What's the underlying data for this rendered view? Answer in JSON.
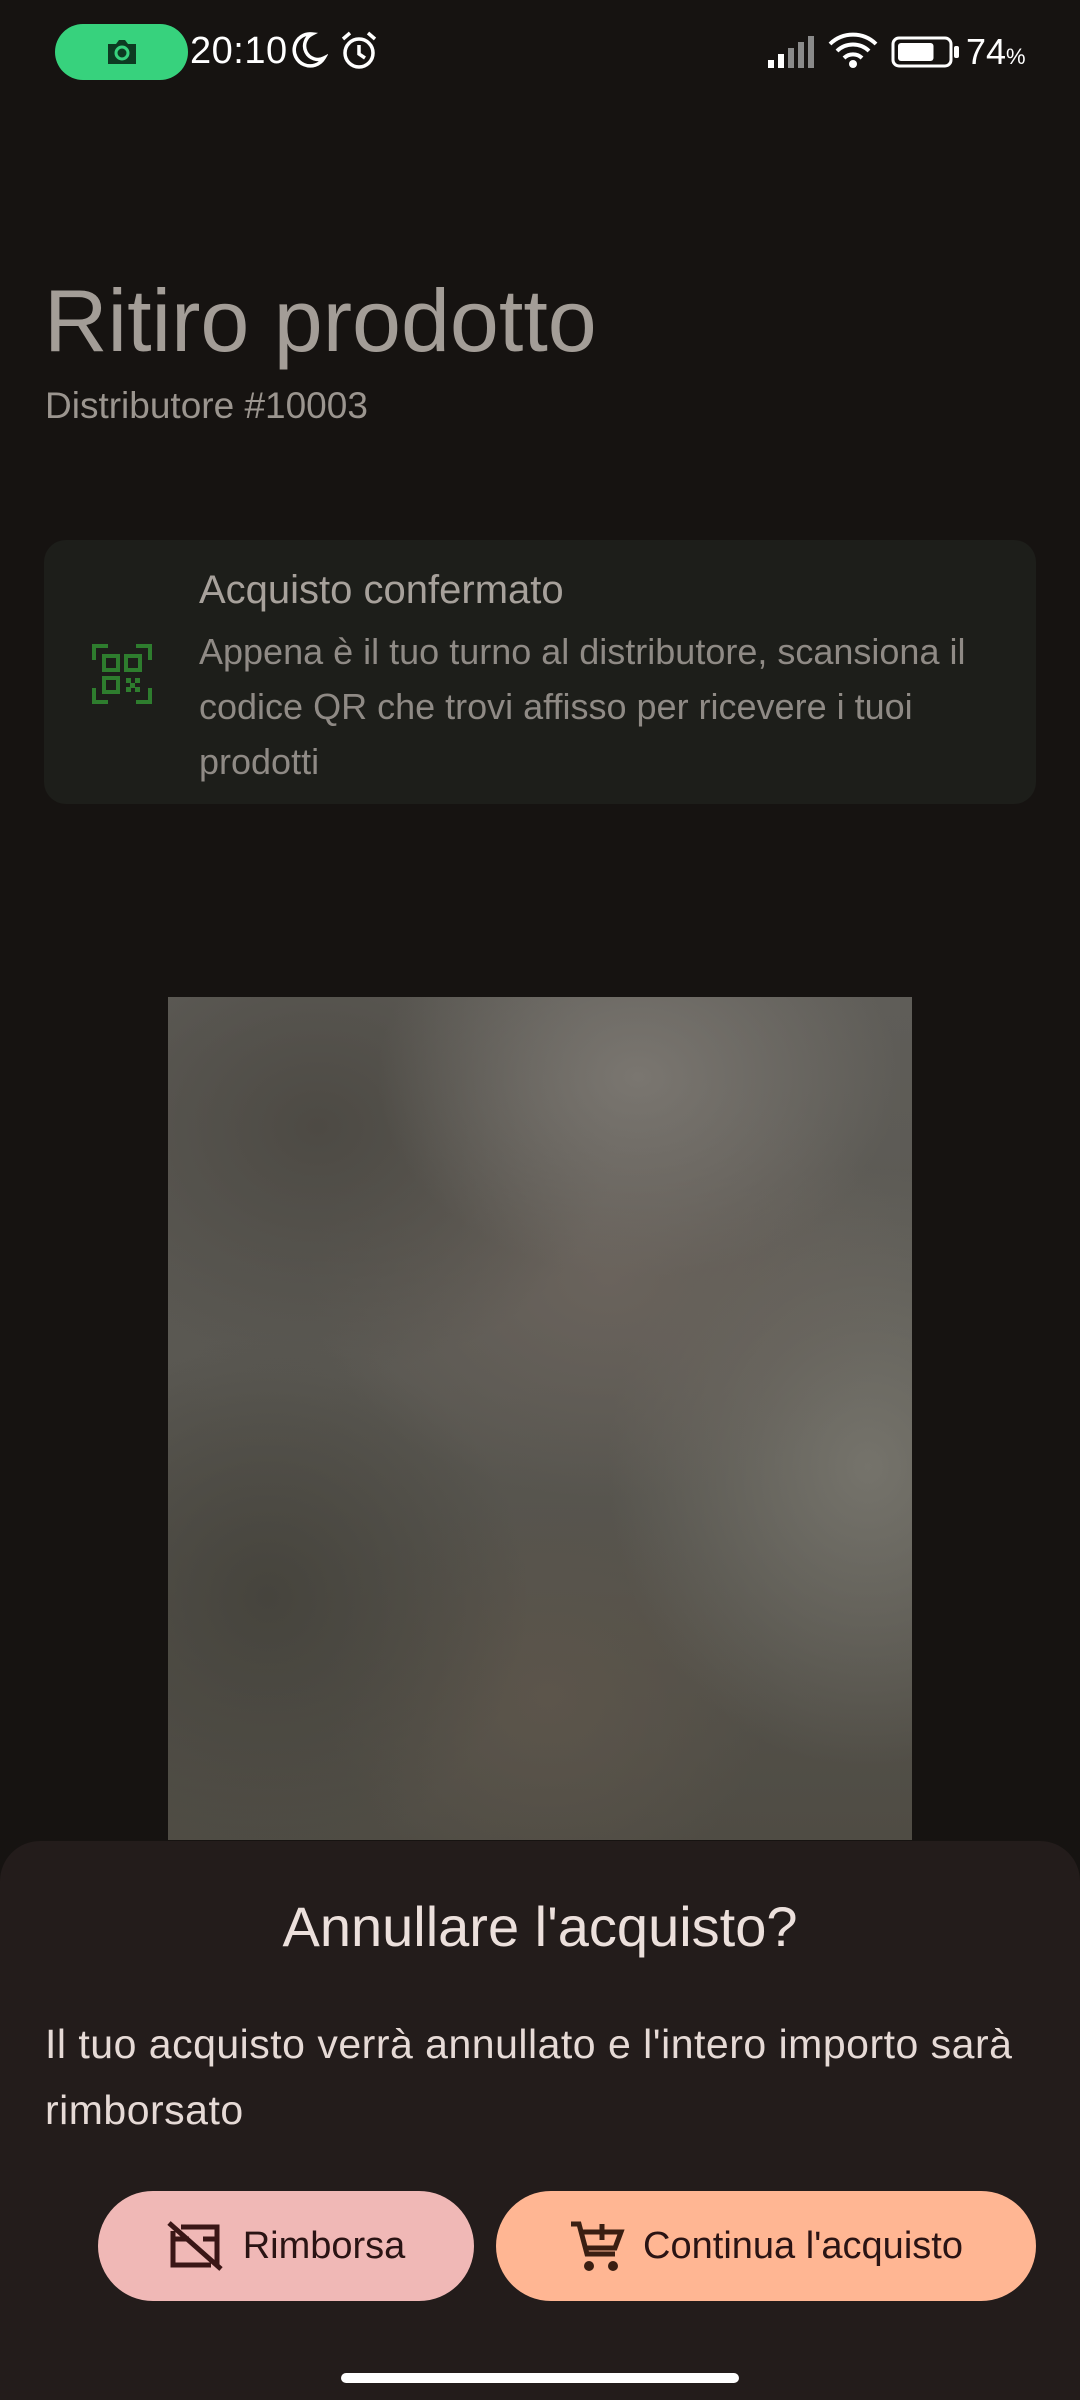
{
  "status_bar": {
    "time": "20:10",
    "battery_text": "74",
    "battery_unit": "%",
    "battery_level": 0.74,
    "icons": [
      "camera-icon",
      "moon-icon",
      "alarm-icon",
      "signal-icon",
      "wifi-icon",
      "battery-icon"
    ]
  },
  "header": {
    "title": "Ritiro prodotto",
    "subtitle": "Distributore #10003"
  },
  "info_card": {
    "icon": "qr-code-scan-icon",
    "title": "Acquisto confermato",
    "text": "Appena è il tuo turno al distributore, scansiona il codice QR che trovi affisso per ricevere i tuoi prodotti"
  },
  "dialog": {
    "title": "Annullare l'acquisto?",
    "body": "Il tuo acquisto verrà annullato e l'intero importo sarà rimborsato",
    "refund_button": {
      "label": "Rimborsa",
      "icon": "card-off-icon"
    },
    "continue_button": {
      "label": "Continua l'acquisto",
      "icon": "add-cart-icon"
    }
  },
  "colors": {
    "background": "#161311",
    "camera_pill": "#37d27d",
    "qr_icon": "#2e7d2e",
    "refund_button": "#f0b8b6",
    "continue_button": "#ffb693",
    "sheet": "#231c1b"
  }
}
